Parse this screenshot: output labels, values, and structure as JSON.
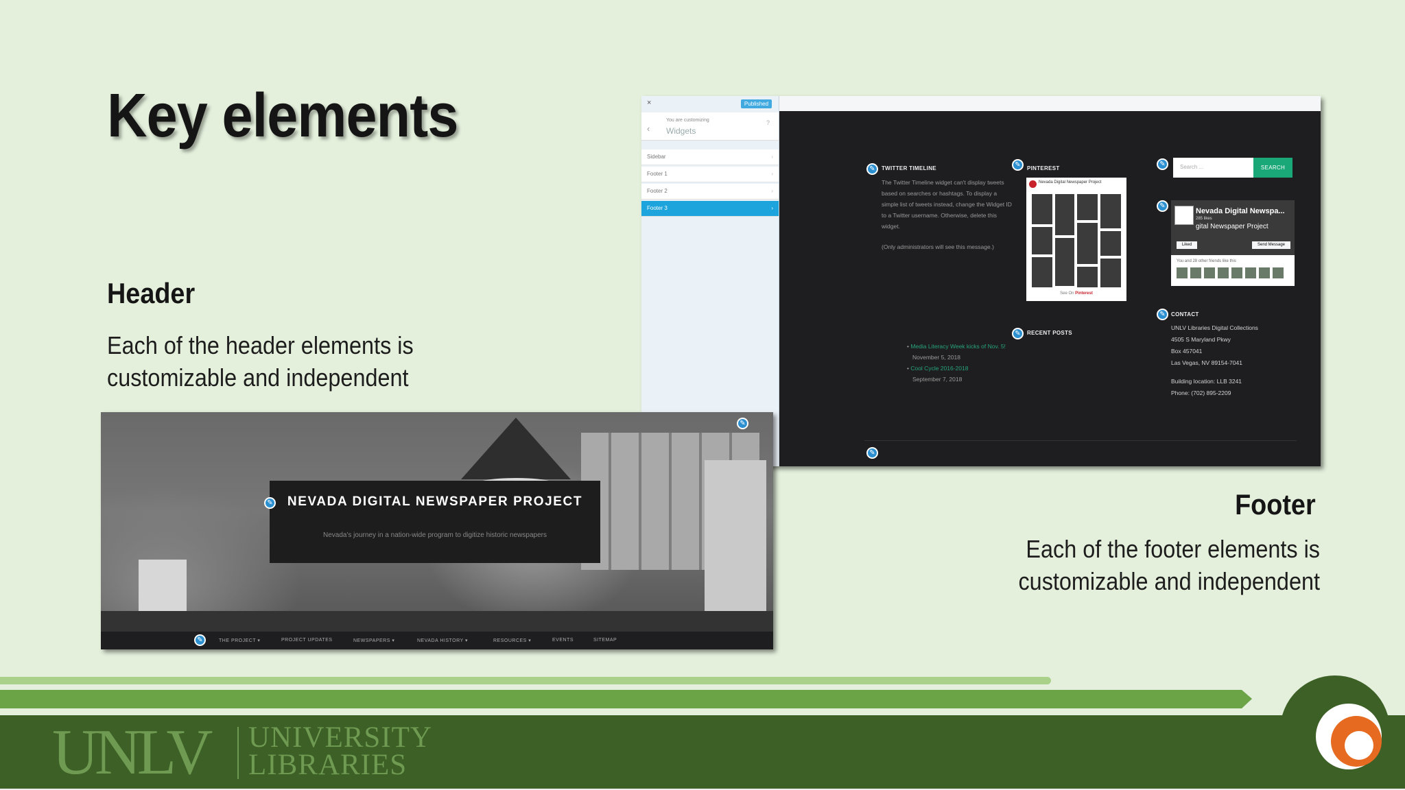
{
  "slide": {
    "title": "Key elements",
    "header_heading": "Header",
    "header_body": "Each of the header elements is customizable and independent",
    "footer_heading": "Footer",
    "footer_body": "Each of the footer elements is customizable and independent"
  },
  "footer_screenshot": {
    "publish_label": "Published",
    "close_glyph": "×",
    "back_glyph": "‹",
    "customizing_label": "You are customizing",
    "panel_title": "Widgets",
    "sidebar_items": [
      {
        "label": "Sidebar",
        "active": false
      },
      {
        "label": "Footer 1",
        "active": false
      },
      {
        "label": "Footer 2",
        "active": false
      },
      {
        "label": "Footer 3",
        "active": true
      }
    ],
    "twitter_title": "TWITTER TIMELINE",
    "twitter_text": "The Twitter Timeline widget can't display tweets based on searches or hashtags. To display a simple list of tweets instead, change the Widget ID to a Twitter username. Otherwise, delete this widget.",
    "twitter_note": "(Only administrators will see this message.)",
    "pinterest_title": "PINTEREST",
    "pinterest_board": "Nevada Digital Newspaper Project",
    "pinterest_footer_prefix": "See On",
    "pinterest_footer_brand": "Pinterest",
    "recent_posts_title": "RECENT POSTS",
    "recent_posts": [
      {
        "link": "Media Literacy Week kicks of Nov. 5!",
        "date": "November 5, 2018"
      },
      {
        "link": "Cool Cycle 2016-2018",
        "date": "September 7, 2018"
      }
    ],
    "search_placeholder": "Search ...",
    "search_button": "SEARCH",
    "facebook_page_name": "Nevada Digital Newspa...",
    "facebook_likes": "285 likes",
    "facebook_sub": "gital Newspaper Project",
    "facebook_like_btn": "Liked",
    "facebook_msg_btn": "Send Message",
    "facebook_friends": "You and 28 other friends like this",
    "contact_title": "CONTACT",
    "contact_lines": [
      "UNLV Libraries Digital Collections",
      "4505 S Maryland Pkwy",
      "Box 457041",
      "Las Vegas, NV 89154-7041"
    ],
    "contact_location": "Building location: LLB 3241",
    "contact_phone": "Phone: (702) 895-2209"
  },
  "header_screenshot": {
    "site_title": "NEVADA DIGITAL NEWSPAPER PROJECT",
    "tagline": "Nevada's journey in a nation-wide program to digitize historic newspapers",
    "nav_items": [
      "THE PROJECT ▾",
      "PROJECT UPDATES",
      "NEWSPAPERS ▾",
      "NEVADA HISTORY ▾",
      "RESOURCES ▾",
      "EVENTS",
      "SITEMAP"
    ]
  },
  "branding": {
    "logo_letters": "UNLV",
    "logo_line1": "UNIVERSITY",
    "logo_line2": "LIBRARIES",
    "colors": {
      "band_dark": "#3d6026",
      "stripe_mid": "#6aa447",
      "stripe_light": "#a9d18a",
      "accent_orange": "#e66a1f",
      "background": "#e4f0dc"
    }
  }
}
